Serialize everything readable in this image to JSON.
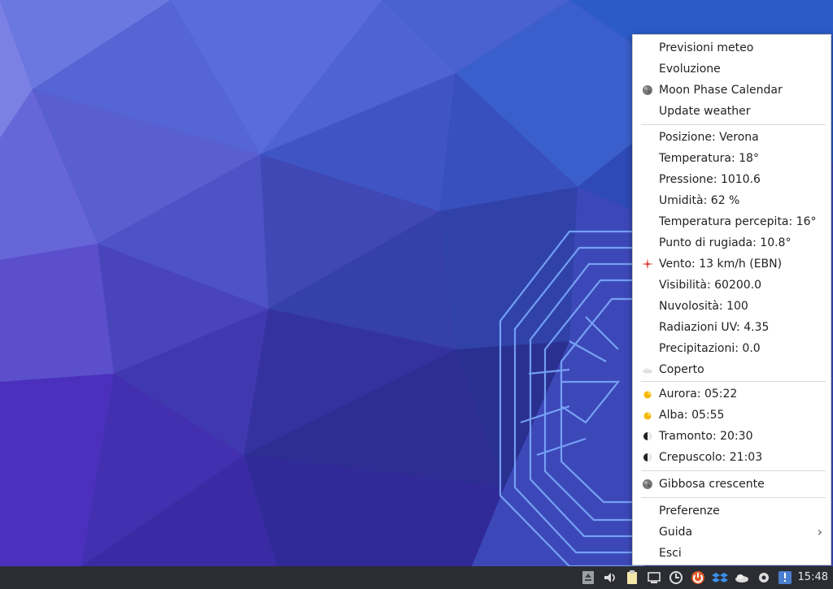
{
  "menu": {
    "top_items": [
      {
        "label": "Previsioni meteo",
        "icon": ""
      },
      {
        "label": "Evoluzione",
        "icon": ""
      },
      {
        "label": "Moon Phase Calendar",
        "icon": "moon-globe-icon"
      },
      {
        "label": "Update weather",
        "icon": ""
      }
    ],
    "weather_items": [
      {
        "label": "Posizione: Verona"
      },
      {
        "label": "Temperatura: 18°"
      },
      {
        "label": "Pressione: 1010.6"
      },
      {
        "label": "Umidità: 62 %"
      },
      {
        "label": "Temperatura percepita: 16°"
      },
      {
        "label": "Punto di rugiada: 10.8°"
      },
      {
        "label": "Vento: 13 km/h (EBN)",
        "icon": "wind-compass-icon"
      },
      {
        "label": "Visibilità: 60200.0"
      },
      {
        "label": "Nuvolosità: 100"
      },
      {
        "label": "Radiazioni UV: 4.35"
      },
      {
        "label": "Precipitazioni: 0.0"
      },
      {
        "label": "Coperto",
        "icon": "cloud-icon"
      }
    ],
    "sun_items": [
      {
        "label": "Aurora: 05:22",
        "icon": "sun-icon"
      },
      {
        "label": "Alba: 05:55",
        "icon": "sun-icon"
      },
      {
        "label": "Tramonto: 20:30",
        "icon": "half-moon-icon"
      },
      {
        "label": "Crepuscolo: 21:03",
        "icon": "half-moon-icon"
      }
    ],
    "moon_item": {
      "label": "Gibbosa crescente",
      "icon": "moon-globe-icon"
    },
    "bottom_items": [
      {
        "label": "Preferenze"
      },
      {
        "label": "Guida",
        "submenu": true
      },
      {
        "label": "Esci"
      }
    ]
  },
  "taskbar": {
    "clock": "15:48",
    "tray_icons": [
      "eject-icon",
      "volume-icon",
      "clipboard-icon",
      "network-icon",
      "update-icon",
      "power-icon",
      "dropbox-icon",
      "weather-icon",
      "settings-icon",
      "notification-icon"
    ]
  },
  "colors": {
    "menu_bg": "#ffffff",
    "taskbar_bg": "#2b2d33",
    "wallpaper_base": "#3a3fae",
    "sun": "#f5b800",
    "wind": "#d44"
  }
}
